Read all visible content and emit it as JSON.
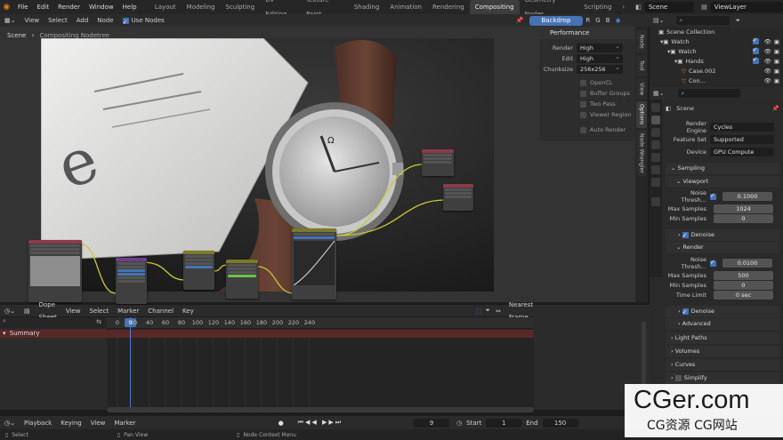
{
  "topbar": {
    "menus": [
      "File",
      "Edit",
      "Render",
      "Window",
      "Help"
    ],
    "workspaces": [
      "Layout",
      "Modeling",
      "Sculpting",
      "UV Editing",
      "Texture Paint",
      "Shading",
      "Animation",
      "Rendering",
      "Compositing",
      "Geometry Nodes",
      "Scripting"
    ],
    "active_workspace": "Compositing",
    "scene": "Scene",
    "view_layer": "ViewLayer"
  },
  "comp_header": {
    "items": [
      "View",
      "Select",
      "Add",
      "Node"
    ],
    "use_nodes": "Use Nodes",
    "backdrop": "Backdrop",
    "channels": [
      "R",
      "G",
      "B"
    ]
  },
  "breadcrumb": {
    "scene": "Scene",
    "tree": "Compositing Nodetree"
  },
  "npanel": {
    "title": "Performance",
    "render_label": "Render",
    "render_value": "High",
    "edit_label": "Edit",
    "edit_value": "High",
    "chunksize_label": "Chunksize",
    "chunksize_value": "256x256",
    "checks": [
      "OpenCL",
      "Buffer Groups",
      "Two Pass",
      "Viewer Region",
      "Auto Render"
    ]
  },
  "vtabs": [
    "Node",
    "Tool",
    "View",
    "Options",
    "Node Wrangler"
  ],
  "outliner": {
    "title": "Scene Collection",
    "rows": [
      {
        "label": "Scene Collection",
        "indent": 0
      },
      {
        "label": "Watch",
        "indent": 1
      },
      {
        "label": "Watch",
        "indent": 2
      },
      {
        "label": "Hands",
        "indent": 3
      },
      {
        "label": "Case.002",
        "indent": 4
      },
      {
        "label": "Con...",
        "indent": 4
      }
    ]
  },
  "properties": {
    "scene_name": "Scene",
    "render_engine_label": "Render Engine",
    "render_engine": "Cycles",
    "feature_set_label": "Feature Set",
    "feature_set": "Supported",
    "device_label": "Device",
    "device": "GPU Compute",
    "sampling": "Sampling",
    "viewport": "Viewport",
    "noise_threshold_label": "Noise Thresh...",
    "viewport_noise": "0.1000",
    "max_samples_label": "Max Samples",
    "viewport_max": "1024",
    "min_samples_label": "Min Samples",
    "viewport_min": "0",
    "denoise": "Denoise",
    "render": "Render",
    "render_noise": "0.0100",
    "render_max": "500",
    "render_min": "0",
    "time_limit_label": "Time Limit",
    "time_limit": "0 sec",
    "render_denoise": "Denoise",
    "advanced": "Advanced",
    "light_paths": "Light Paths",
    "volumes": "Volumes",
    "curves": "Curves",
    "simplify": "Simplify"
  },
  "dopesheet": {
    "mode": "Dope Sheet",
    "menus": [
      "View",
      "Select",
      "Marker",
      "Channel",
      "Key"
    ],
    "snap": "Nearest Frame",
    "summary": "Summary",
    "current_frame": "9",
    "ticks": [
      "0",
      "20",
      "40",
      "60",
      "80",
      "100",
      "120",
      "140",
      "160",
      "180",
      "200",
      "220",
      "240"
    ]
  },
  "timeline": {
    "menus": [
      "Playback",
      "Keying",
      "View",
      "Marker"
    ],
    "frame": "9",
    "start_label": "Start",
    "start": "1",
    "end_label": "End",
    "end": "150"
  },
  "statusbar": [
    "Select",
    "Pan View",
    "Node Context Menu"
  ],
  "watermark": {
    "main": "CGer.com",
    "sub": "CG资源 CG网站"
  }
}
